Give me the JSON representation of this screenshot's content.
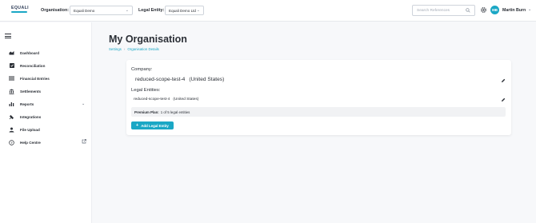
{
  "header": {
    "logo_text": "EQUALI",
    "organisation_label": "Organisation:",
    "organisation_value": "Equali Demo",
    "legal_entity_label": "Legal Entity:",
    "legal_entity_value": "Equali Demo Ltd",
    "search_placeholder": "Search References",
    "user_initials": "MB",
    "user_name": "Martin Burn",
    "accent_color": "#1aa7c5"
  },
  "sidebar": {
    "items": [
      {
        "label": "Dashboard",
        "icon": "chart-area-icon"
      },
      {
        "label": "Reconciliation",
        "icon": "checkbox-icon"
      },
      {
        "label": "Financial Entries",
        "icon": "list-icon"
      },
      {
        "label": "Settlements",
        "icon": "bank-icon"
      },
      {
        "label": "Reports",
        "icon": "bar-chart-icon"
      },
      {
        "label": "Integrations",
        "icon": "plug-icon"
      },
      {
        "label": "File Upload",
        "icon": "upload-user-icon"
      },
      {
        "label": "Help Centre",
        "icon": "help-icon"
      }
    ]
  },
  "page": {
    "title": "My Organisation",
    "breadcrumb": [
      "Settings",
      "Organisation Details"
    ]
  },
  "card": {
    "company_label": "Company:",
    "company_name": "reduced-scope-test-4",
    "company_country": "(United States)",
    "legal_entities_label": "Legal Entities:",
    "legal_entity_name": "reduced-scope-test-4",
    "legal_entity_country": "(United States)",
    "plan_label": "Premium Plan:",
    "plan_value": "1 of 5 legal entities",
    "add_button": "Add Legal Entity"
  }
}
